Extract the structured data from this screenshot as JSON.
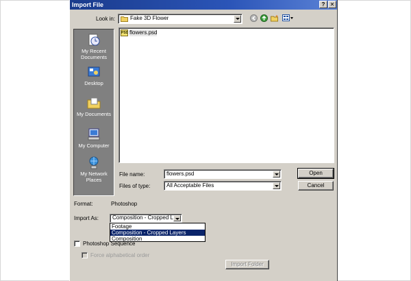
{
  "dialog": {
    "title": "Import File",
    "help_button": "?",
    "close_button": "✕"
  },
  "look_in": {
    "label": "Look in:",
    "value": "Fake 3D Flower"
  },
  "toolbar": {
    "icons": [
      "back-icon",
      "up-folder-icon",
      "new-folder-icon",
      "view-menu-icon"
    ]
  },
  "places": [
    {
      "label": "My Recent Documents",
      "icon": "recent-documents-icon"
    },
    {
      "label": "Desktop",
      "icon": "desktop-icon"
    },
    {
      "label": "My Documents",
      "icon": "my-documents-icon"
    },
    {
      "label": "My Computer",
      "icon": "my-computer-icon"
    },
    {
      "label": "My Network Places",
      "icon": "network-places-icon"
    }
  ],
  "files": [
    {
      "name": "flowers.psd",
      "icon": "psd-file-icon",
      "icon_text": "PSD"
    }
  ],
  "file_name": {
    "label": "File name:",
    "value": "flowers.psd"
  },
  "files_of_type": {
    "label": "Files of type:",
    "value": "All Acceptable Files"
  },
  "buttons": {
    "open": "Open",
    "cancel": "Cancel",
    "import_folder": "Import Folder"
  },
  "format": {
    "label": "Format:",
    "value": "Photoshop"
  },
  "import_as": {
    "label": "Import As:",
    "value": "Composition - Cropped Lay",
    "options": [
      "Footage",
      "Composition - Cropped Layers",
      "Composition"
    ],
    "selected_index": 1
  },
  "photoshop_sequence": {
    "label": "Photoshop Sequence",
    "checked": false
  },
  "force_alphabetical": {
    "label": "Force alphabetical order",
    "checked": false,
    "disabled": true
  },
  "colors": {
    "titlebar": "#2b55b8",
    "dialog_bg": "#d4d0c8",
    "selection": "#0a246a"
  }
}
